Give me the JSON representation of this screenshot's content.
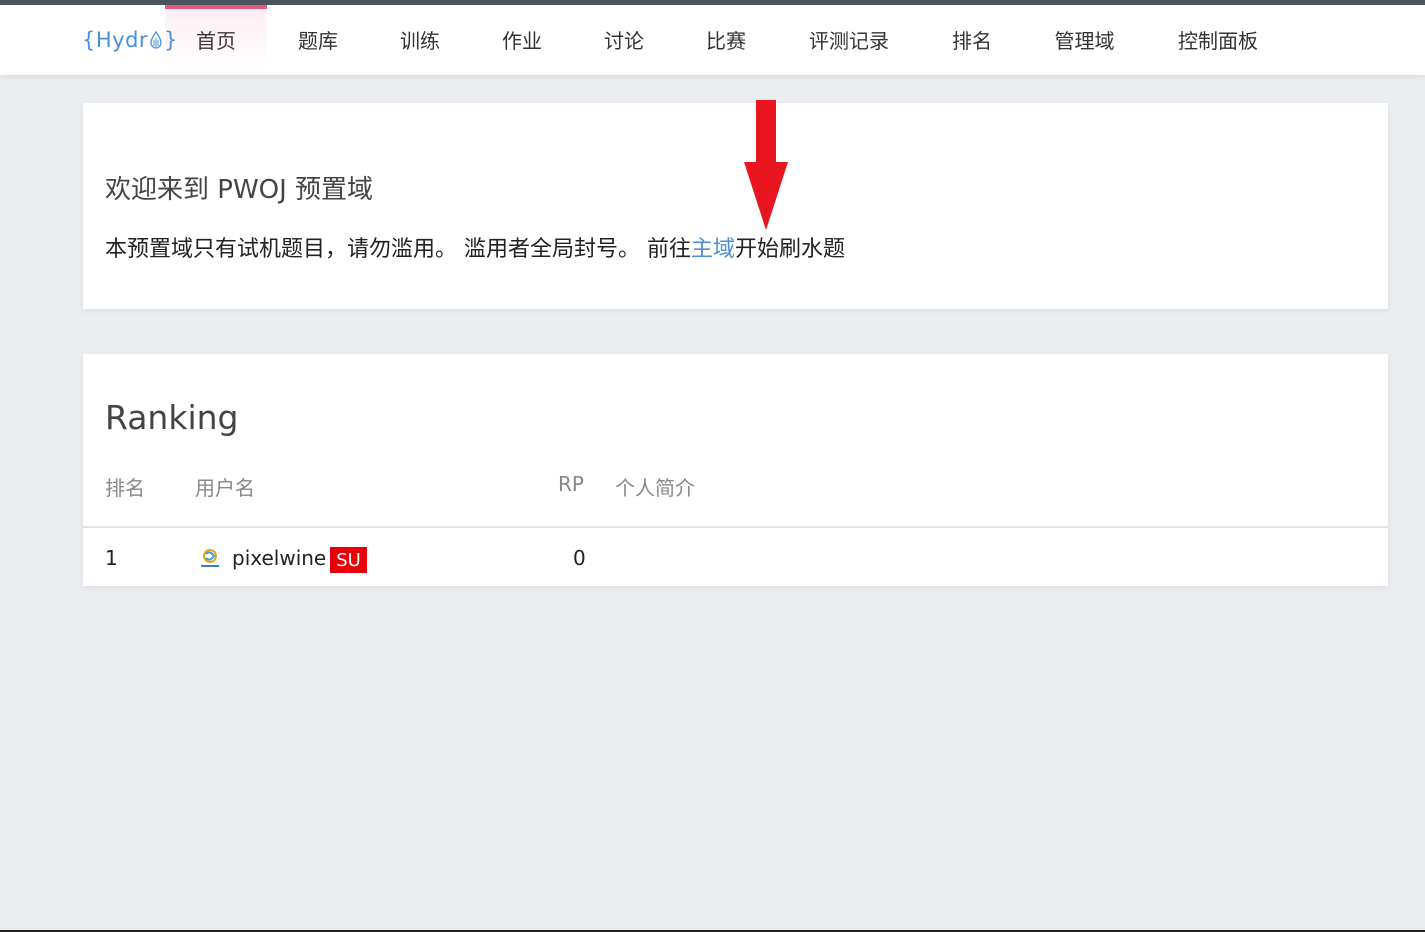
{
  "nav": {
    "logo_left": "{Hydr",
    "logo_right": "}",
    "items": [
      {
        "label": "首页"
      },
      {
        "label": "题库"
      },
      {
        "label": "训练"
      },
      {
        "label": "作业"
      },
      {
        "label": "讨论"
      },
      {
        "label": "比赛"
      },
      {
        "label": "评测记录"
      },
      {
        "label": "排名"
      },
      {
        "label": "管理域"
      },
      {
        "label": "控制面板"
      }
    ],
    "active_index": 0
  },
  "welcome": {
    "title": "欢迎来到 PWOJ 预置域",
    "text_before": "本预置域只有试机题目，请勿滥用。 滥用者全局封号。 前往",
    "link": "主域",
    "text_after": "开始刷水题"
  },
  "ranking": {
    "title": "Ranking",
    "headers": {
      "rank": "排名",
      "username": "用户名",
      "rp": "RP",
      "bio": "个人简介"
    },
    "rows": [
      {
        "rank": "1",
        "username": "pixelwine",
        "badge": "SU",
        "rp": "0",
        "bio": ""
      }
    ]
  },
  "colors": {
    "accent": "#e45a84",
    "link": "#4d8fd1",
    "badge": "#e8000b",
    "arrow": "#e8141f"
  }
}
